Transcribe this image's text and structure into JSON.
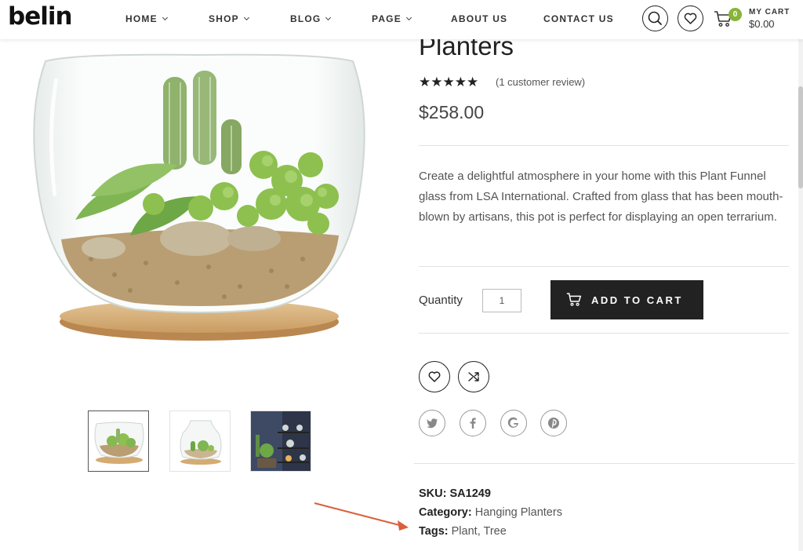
{
  "header": {
    "logo": "belin",
    "nav": [
      {
        "label": "HOME",
        "dropdown": true
      },
      {
        "label": "SHOP",
        "dropdown": true
      },
      {
        "label": "BLOG",
        "dropdown": true
      },
      {
        "label": "PAGE",
        "dropdown": true
      },
      {
        "label": "ABOUT US",
        "dropdown": false
      },
      {
        "label": "CONTACT US",
        "dropdown": false
      }
    ],
    "cart": {
      "count": "0",
      "label": "MY CART",
      "total": "$0.00"
    },
    "icons": [
      "search-icon",
      "heart-icon",
      "cart-icon"
    ]
  },
  "product": {
    "title": "Planters",
    "rating": {
      "stars": "★★★★★",
      "value": 5,
      "max": 5,
      "review_text": "(1 customer review)"
    },
    "price": "$258.00",
    "description": "Create a delightful atmosphere in your home with this Plant Funnel glass from LSA International. Crafted from glass that has been mouth-blown by artisans, this pot is perfect for displaying an open terrarium.",
    "quantity_label": "Quantity",
    "quantity_value": "1",
    "add_to_cart": "ADD TO CART",
    "actions": [
      "wishlist-heart-icon",
      "compare-shuffle-icon"
    ],
    "share": [
      "twitter-icon",
      "facebook-icon",
      "google-icon",
      "pinterest-icon"
    ],
    "meta": {
      "sku_label": "SKU:",
      "sku": "SA1249",
      "category_label": "Category:",
      "category": "Hanging Planters",
      "tags_label": "Tags:",
      "tag1": "Plant",
      "tag_sep": ",",
      "tag2": "Tree"
    },
    "thumbnails": [
      "thumbnail-terrarium-bowl",
      "thumbnail-terrarium-jar",
      "thumbnail-shelf-room"
    ]
  },
  "colors": {
    "accent": "#86b43a",
    "button": "#222222",
    "annotation_arrow": "#d9603b"
  }
}
